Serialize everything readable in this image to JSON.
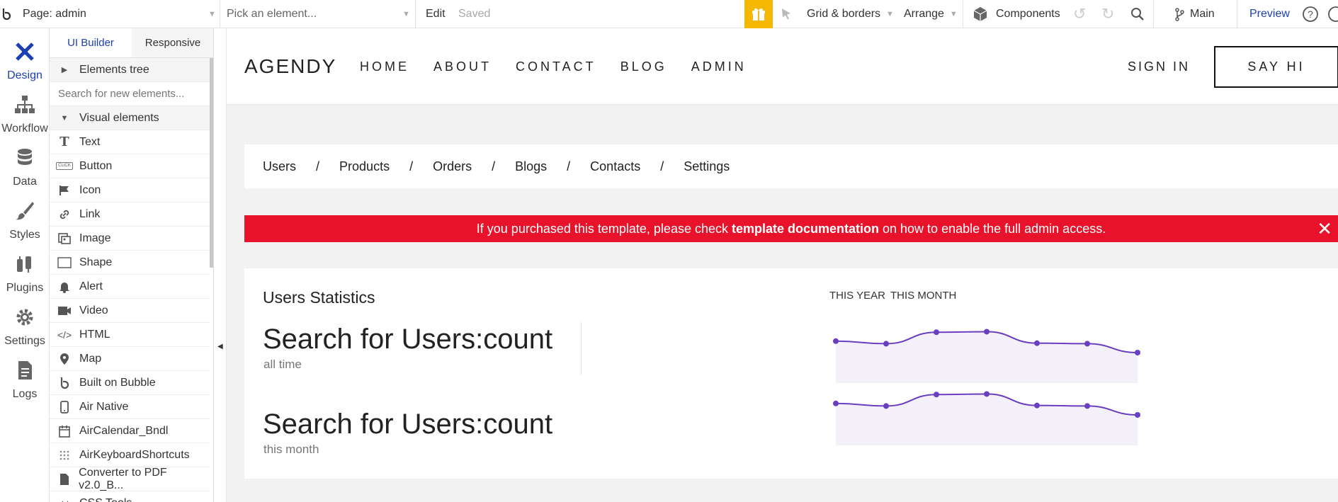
{
  "topbar": {
    "page_label": "Page: admin",
    "element_placeholder": "Pick an element...",
    "edit": "Edit",
    "saved": "Saved",
    "grid": "Grid & borders",
    "arrange": "Arrange",
    "components": "Components",
    "branch": "Main",
    "preview": "Preview"
  },
  "leftnav": {
    "items": [
      {
        "label": "Design"
      },
      {
        "label": "Workflow"
      },
      {
        "label": "Data"
      },
      {
        "label": "Styles"
      },
      {
        "label": "Plugins"
      },
      {
        "label": "Settings"
      },
      {
        "label": "Logs"
      }
    ]
  },
  "panel": {
    "tabs": [
      {
        "label": "UI Builder"
      },
      {
        "label": "Responsive"
      }
    ],
    "elements_tree": "Elements tree",
    "search_placeholder": "Search for new elements...",
    "visual_elements": "Visual elements",
    "items": [
      {
        "label": "Text",
        "icon": "text-icon"
      },
      {
        "label": "Button",
        "icon": "button-icon"
      },
      {
        "label": "Icon",
        "icon": "flag-icon"
      },
      {
        "label": "Link",
        "icon": "link-icon"
      },
      {
        "label": "Image",
        "icon": "image-icon"
      },
      {
        "label": "Shape",
        "icon": "shape-icon"
      },
      {
        "label": "Alert",
        "icon": "bell-icon"
      },
      {
        "label": "Video",
        "icon": "video-icon"
      },
      {
        "label": "HTML",
        "icon": "code-icon"
      },
      {
        "label": "Map",
        "icon": "map-pin-icon"
      },
      {
        "label": "Built on Bubble",
        "icon": "bubble-icon"
      },
      {
        "label": "Air Native",
        "icon": "phone-icon"
      },
      {
        "label": "AirCalendar_Bndl",
        "icon": "calendar-icon"
      },
      {
        "label": "AirKeyboardShortcuts",
        "icon": "grid-dots-icon"
      },
      {
        "label": "Converter to PDF v2.0_B...",
        "icon": "document-icon"
      },
      {
        "label": "CSS Tools",
        "icon": "tools-icon"
      }
    ]
  },
  "site": {
    "logo": "AGENDY",
    "menu": [
      "HOME",
      "ABOUT",
      "CONTACT",
      "BLOG",
      "ADMIN"
    ],
    "signin": "SIGN IN",
    "sayhi": "SAY HI",
    "breadcrumbs": [
      "Users",
      "Products",
      "Orders",
      "Blogs",
      "Contacts",
      "Settings"
    ],
    "breadcrumb_sep": "/",
    "alert": {
      "pre": "If you purchased this template, please check",
      "bold": "template documentation",
      "post": "on how to enable the full admin access.",
      "close": "✕"
    },
    "stats": {
      "title": "Users Statistics",
      "count1": "Search for Users:count",
      "label1": "all time",
      "count2": "Search for Users:count",
      "label2": "this month",
      "period_year": "THIS YEAR",
      "period_month": "THIS MONTH"
    }
  },
  "colors": {
    "accent": "#1a3fb5",
    "alert_red": "#e8132a",
    "spark_line": "#6a3fbf",
    "spark_fill": "#f3f0fa",
    "gift_bg": "#f5b800"
  },
  "chart_data": [
    {
      "type": "area",
      "values": [
        0.2,
        0.1,
        0.55,
        0.57,
        0.12,
        0.1,
        -0.25
      ]
    },
    {
      "type": "area",
      "values": [
        0.2,
        0.1,
        0.55,
        0.57,
        0.12,
        0.1,
        -0.25
      ]
    }
  ]
}
